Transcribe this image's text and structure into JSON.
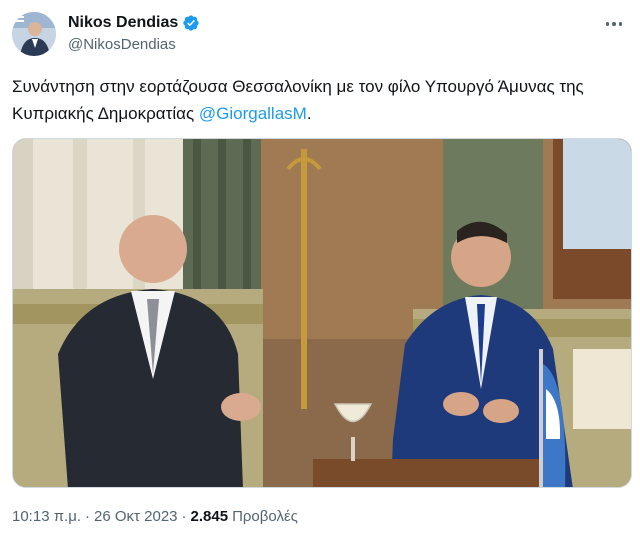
{
  "author": {
    "display_name": "Nikos Dendias",
    "handle": "@NikosDendias",
    "verified": true,
    "avatar_icon": "profile-photo"
  },
  "tweet": {
    "text_before_mention": "Συνάντηση στην εορτάζουσα Θεσσαλονίκη με τον φίλο Υπουργό Άμυνας της Κυπριακής Δημοκρατίας ",
    "mention": "@GiorgallasM",
    "text_after_mention": "."
  },
  "media": {
    "image_icon": "photo-two-men-meeting"
  },
  "meta": {
    "time": "10:13 π.μ.",
    "separator": "·",
    "date": "26 Οκτ 2023",
    "separator2": "·",
    "views_count": "2.845",
    "views_label": "Προβολές"
  },
  "colors": {
    "link": "#1d9bf0",
    "secondary_text": "#536471",
    "primary_text": "#0f1419",
    "verified_badge": "#1d9bf0"
  }
}
